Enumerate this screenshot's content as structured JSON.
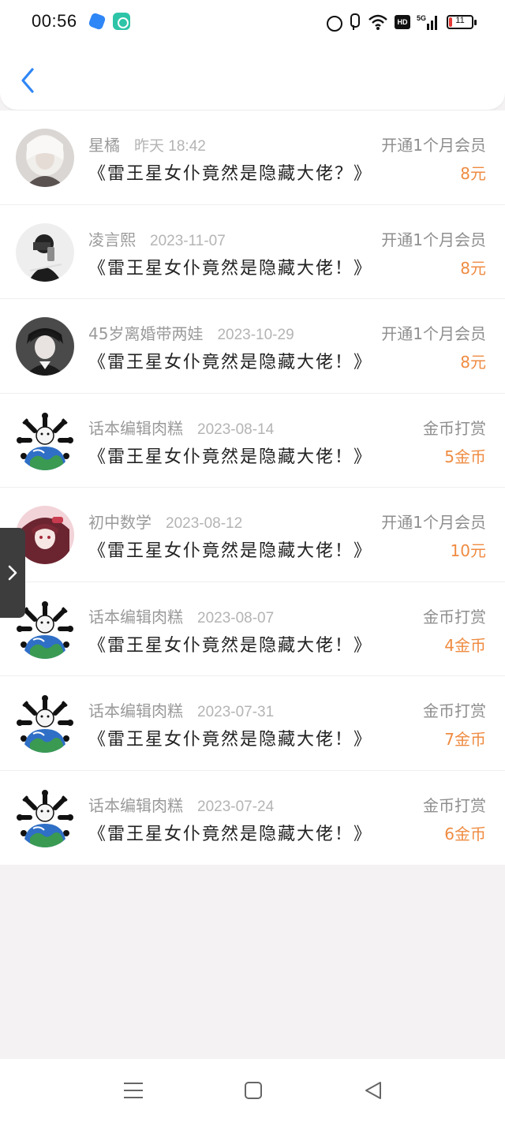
{
  "status": {
    "time": "00:56",
    "battery": "11",
    "hd_label": "HD"
  },
  "header": {
    "back_icon": "chevron-left-icon",
    "accent_color": "#2f86f6"
  },
  "list": [
    {
      "name": "星橘",
      "date": "昨天 18:42",
      "book": "《雷王星女仆竟然是隐藏大佬？》",
      "action": "开通1个月会员",
      "amount": "8元",
      "avatar": "white-hair-girl"
    },
    {
      "name": "凌言熙",
      "date": "2023-11-07",
      "book": "《雷王星女仆竟然是隐藏大佬！》",
      "action": "开通1个月会员",
      "amount": "8元",
      "avatar": "mirror-selfie"
    },
    {
      "name": "45岁离婚带两娃",
      "date": "2023-10-29",
      "book": "《雷王星女仆竟然是隐藏大佬！》",
      "action": "开通1个月会员",
      "amount": "8元",
      "avatar": "dark-hair-boy"
    },
    {
      "name": "话本编辑肉糕",
      "date": "2023-08-14",
      "book": "《雷王星女仆竟然是隐藏大佬！》",
      "action": "金币打赏",
      "amount": "5金币",
      "avatar": "dog-bones-earth"
    },
    {
      "name": "初中数学",
      "date": "2023-08-12",
      "book": "《雷王星女仆竟然是隐藏大佬！》",
      "action": "开通1个月会员",
      "amount": "10元",
      "avatar": "anime-girl-red"
    },
    {
      "name": "话本编辑肉糕",
      "date": "2023-08-07",
      "book": "《雷王星女仆竟然是隐藏大佬！》",
      "action": "金币打赏",
      "amount": "4金币",
      "avatar": "dog-bones-earth"
    },
    {
      "name": "话本编辑肉糕",
      "date": "2023-07-31",
      "book": "《雷王星女仆竟然是隐藏大佬！》",
      "action": "金币打赏",
      "amount": "7金币",
      "avatar": "dog-bones-earth"
    },
    {
      "name": "话本编辑肉糕",
      "date": "2023-07-24",
      "book": "《雷王星女仆竟然是隐藏大佬！》",
      "action": "金币打赏",
      "amount": "6金币",
      "avatar": "dog-bones-earth"
    }
  ],
  "colors": {
    "amount": "#ef8b41",
    "muted": "#9a9a9a",
    "side_tab": "#3d3d3d"
  },
  "navbar": {
    "icons": [
      "menu-icon",
      "home-square-icon",
      "back-triangle-icon"
    ]
  }
}
